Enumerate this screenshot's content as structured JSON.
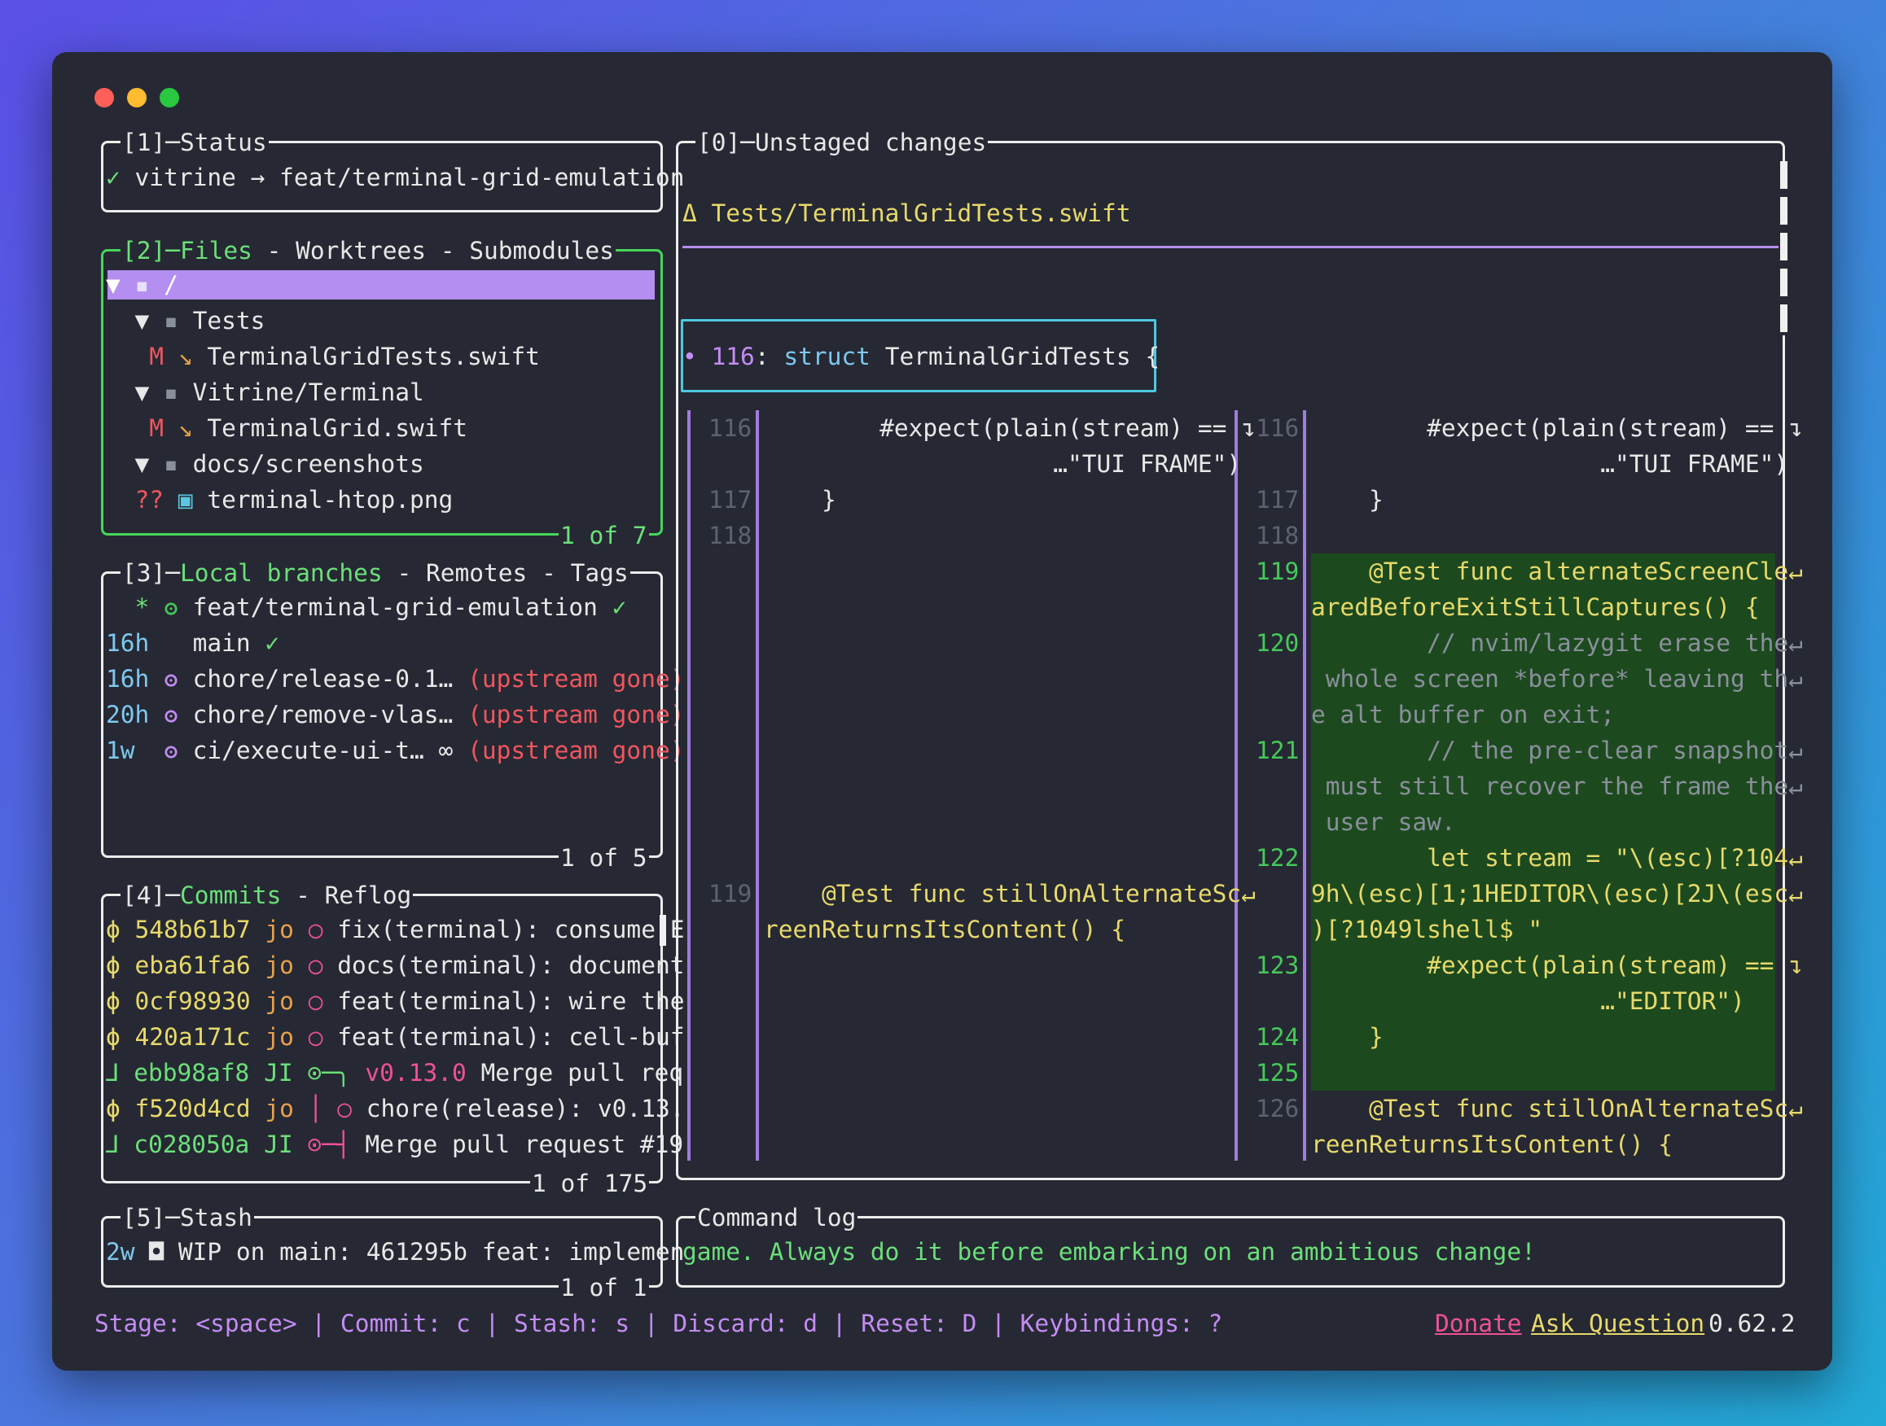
{
  "window": {
    "traffic_lights": [
      "#ff5f57",
      "#febc2e",
      "#28c840"
    ]
  },
  "status": {
    "title": "[1]─Status",
    "check": "✓",
    "repo": "vitrine",
    "arrow": "→",
    "branch": "feat/terminal-grid-emulation"
  },
  "files": {
    "title_num": "[2]─",
    "title_active": "Files",
    "title_rest": " - Worktrees - Submodules",
    "counter": "1 of 7",
    "rows": [
      {
        "marker": "▼",
        "icon": "folder-icon",
        "name": "/"
      },
      {
        "marker": "▼",
        "icon": "folder-icon",
        "name": "Tests"
      },
      {
        "status": "M",
        "icon": "swift-icon",
        "name": "TerminalGridTests.swift"
      },
      {
        "marker": "▼",
        "icon": "folder-icon",
        "name": "Vitrine/Terminal"
      },
      {
        "status": "M",
        "icon": "swift-icon",
        "name": "TerminalGrid.swift"
      },
      {
        "marker": "▼",
        "icon": "folder-icon",
        "name": "docs/screenshots"
      },
      {
        "status": "??",
        "icon": "image-file-icon",
        "name": "terminal-htop.png"
      }
    ]
  },
  "branches": {
    "title_num": "[3]─",
    "title_active": "Local branches",
    "title_rest": " - Remotes - Tags",
    "counter": "1 of 5",
    "rows": [
      {
        "age": "*",
        "name": "feat/terminal-grid-emulation",
        "status": "✓"
      },
      {
        "age": "16h",
        "name": "main",
        "status": "✓"
      },
      {
        "age": "16h",
        "name": "chore/release-0.1…",
        "status": "(upstream gone)"
      },
      {
        "age": "20h",
        "name": "chore/remove-vlas…",
        "status": "(upstream gone)"
      },
      {
        "age": "1w",
        "name": "ci/execute-ui-t…",
        "status": "(upstream gone)"
      }
    ]
  },
  "commits": {
    "title_num": "[4]─",
    "title_active": "Commits",
    "title_rest": " - Reflog",
    "counter": "1 of 175",
    "rows": [
      {
        "hash": "548b61b7",
        "author": "jo",
        "graph": "○",
        "msg": "fix(terminal): consume E"
      },
      {
        "hash": "eba61fa6",
        "author": "jo",
        "graph": "○",
        "msg": "docs(terminal): document"
      },
      {
        "hash": "0cf98930",
        "author": "jo",
        "graph": "○",
        "msg": "feat(terminal): wire the"
      },
      {
        "hash": "420a171c",
        "author": "jo",
        "graph": "○",
        "msg": "feat(terminal): cell-buf"
      },
      {
        "hash": "ebb98af8",
        "author": "JI",
        "graph": "⊙─╮",
        "tag": "v0.13.0",
        "msg": "Merge pull req"
      },
      {
        "hash": "f520d4cd",
        "author": "jo",
        "graph": "│ ○",
        "msg": "chore(release): v0.13."
      },
      {
        "hash": "c028050a",
        "author": "JI",
        "graph": "⊙─┤",
        "msg": "Merge pull request #19"
      }
    ]
  },
  "stash": {
    "title": "[5]─Stash",
    "counter": "1 of 1",
    "age": "2w",
    "msg": "WIP on main: 461295b feat: implemen"
  },
  "diff": {
    "title": "[0]─Unstaged changes",
    "file": "Δ Tests/TerminalGridTests.swift",
    "hunk_num": "116",
    "hunk_text": "struct TerminalGridTests {"
  },
  "diff_lines": {
    "left": [
      {
        "n": "116",
        "t": "        #expect(plain(stream) == ↴"
      },
      {
        "n": "",
        "t": "                    …\"TUI FRAME\")"
      },
      {
        "n": "117",
        "t": "    }"
      },
      {
        "n": "118",
        "t": ""
      },
      {
        "n": "119",
        "t": "    @Test func stillOnAlternateSc↵"
      },
      {
        "n": "",
        "t": "reenReturnsItsContent() {"
      }
    ],
    "right": [
      {
        "n": "116",
        "t": "        #expect(plain(stream) == ↴"
      },
      {
        "n": "",
        "t": "                    …\"TUI FRAME\")"
      },
      {
        "n": "117",
        "t": "    }"
      },
      {
        "n": "118",
        "t": ""
      },
      {
        "n": "119",
        "t": "    @Test func alternateScreenCle↵"
      },
      {
        "n": "",
        "t": "aredBeforeExitStillCaptures() {"
      },
      {
        "n": "120",
        "t": "        // nvim/lazygit erase the↵"
      },
      {
        "n": "",
        "t": " whole screen *before* leaving th↵"
      },
      {
        "n": "",
        "t": "e alt buffer on exit;"
      },
      {
        "n": "121",
        "t": "        // the pre-clear snapshot↵"
      },
      {
        "n": "",
        "t": " must still recover the frame the↵"
      },
      {
        "n": "",
        "t": " user saw."
      },
      {
        "n": "122",
        "t": "        let stream = \"\\(esc)[?104↵"
      },
      {
        "n": "",
        "t": "9h\\(esc)[1;1HEDITOR\\(esc)[2J\\(esc↵"
      },
      {
        "n": "",
        "t": ")[?1049lshell$ \""
      },
      {
        "n": "123",
        "t": "        #expect(plain(stream) == ↴"
      },
      {
        "n": "",
        "t": "                    …\"EDITOR\")"
      },
      {
        "n": "124",
        "t": "    }"
      },
      {
        "n": "125",
        "t": ""
      },
      {
        "n": "126",
        "t": "    @Test func stillOnAlternateSc↵"
      },
      {
        "n": "",
        "t": "reenReturnsItsContent() {"
      }
    ]
  },
  "command_log": {
    "title": "Command log",
    "text": "game. Always do it before embarking on an ambitious change!"
  },
  "footer": {
    "keys": "Stage: <space> | Commit: c | Stash: s | Discard: d | Reset: D | Keybindings: ?",
    "donate": "Donate",
    "ask": "Ask Question",
    "version": "0.62.2"
  }
}
